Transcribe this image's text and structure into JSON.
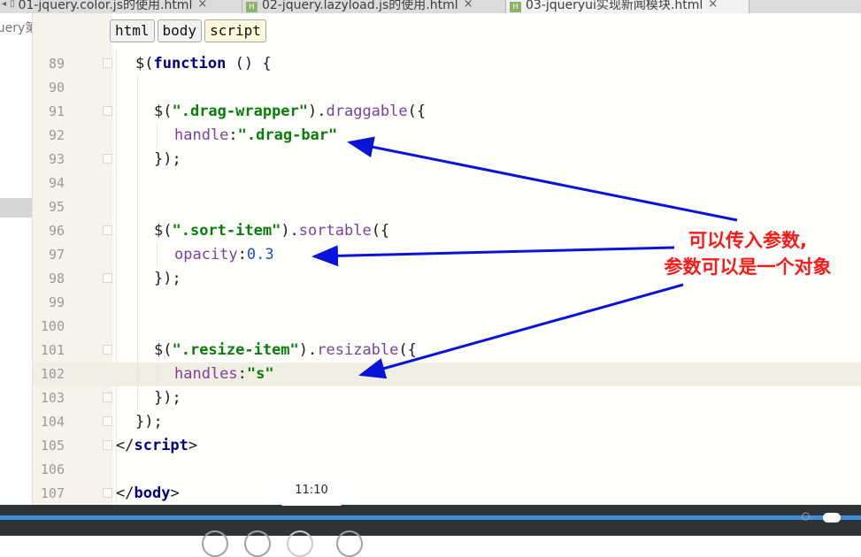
{
  "tabs": [
    {
      "label": "01-jquery.color.js的使用.html",
      "active": false
    },
    {
      "label": "02-jquery.lazyload.js的使用.html",
      "active": false
    },
    {
      "label": "03-jqueryui实现新闻模块.html",
      "active": true
    }
  ],
  "tab_file_badge": "H",
  "tab_close": "×",
  "project": {
    "label": "jquery第"
  },
  "breadcrumb": [
    "html",
    "body",
    "script"
  ],
  "current_line": 102,
  "lines": [
    {
      "n": "89"
    },
    {
      "n": "90"
    },
    {
      "n": "91"
    },
    {
      "n": "92"
    },
    {
      "n": "93"
    },
    {
      "n": "94"
    },
    {
      "n": "95"
    },
    {
      "n": "96"
    },
    {
      "n": "97"
    },
    {
      "n": "98"
    },
    {
      "n": "99"
    },
    {
      "n": "100"
    },
    {
      "n": "101"
    },
    {
      "n": "102"
    },
    {
      "n": "103"
    },
    {
      "n": "104"
    },
    {
      "n": "105"
    },
    {
      "n": "106"
    },
    {
      "n": "107"
    }
  ],
  "code": {
    "l89": {
      "dollar": "$(",
      "kw": "function",
      "rest": " () {"
    },
    "l91": {
      "open": "$(",
      "sel": "\".drag-wrapper\"",
      "mid": ").",
      "method": "draggable",
      "tail": "({"
    },
    "l92": {
      "key": "handle",
      "colon": ":",
      "val": "\".drag-bar\""
    },
    "l93": {
      "text": "});"
    },
    "l96": {
      "open": "$(",
      "sel": "\".sort-item\"",
      "mid": ").",
      "method": "sortable",
      "tail": "({"
    },
    "l97": {
      "key": "opacity",
      "colon": ":",
      "val": "0.3"
    },
    "l98": {
      "text": "});"
    },
    "l101": {
      "open": "$(",
      "sel": "\".resize-item\"",
      "mid": ").",
      "method": "resizable",
      "tail": "({"
    },
    "l102": {
      "key": "handles",
      "colon": ":",
      "val": "\"s\""
    },
    "l103": {
      "text": "});"
    },
    "l104": {
      "text": "});"
    },
    "l105": {
      "open": "</",
      "tag": "script",
      "close": ">"
    },
    "l107": {
      "open": "</",
      "tag": "body",
      "close": ">"
    }
  },
  "annotation": {
    "line1": "可以传入参数,",
    "line2": "参数可以是一个对象"
  },
  "video": {
    "time_tooltip": "11:10",
    "progress": 1.0
  },
  "colors": {
    "annotation_text": "#ff1818",
    "arrow": "#0a14d8",
    "progress": "#3d8fd9"
  }
}
